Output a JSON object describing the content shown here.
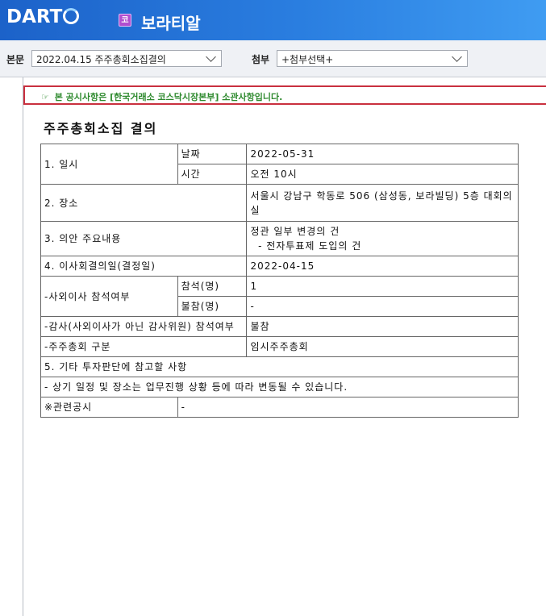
{
  "header": {
    "logo_text": "DART",
    "corp_badge": "코",
    "corp_name": "보라티알"
  },
  "toolbar": {
    "main_label": "본문",
    "main_select_value": "2022.04.15  주주총회소집결의",
    "attach_label": "첨부",
    "attach_select_value": "+첨부선택+"
  },
  "notice": {
    "icon": "☞",
    "text": "본 공시사항은 [한국거래소 코스닥시장본부] 소관사항입니다."
  },
  "document": {
    "title": "주주총회소집 결의",
    "rows": {
      "date_label": "1. 일시",
      "date_sub": "날짜",
      "date_value": "2022-05-31",
      "time_sub": "시간",
      "time_value": "오전 10시",
      "place_label": "2. 장소",
      "place_value": "서울시 강남구 학동로 506 (삼성동, 보라빌딩) 5층 대회의실",
      "agenda_label": "3. 의안 주요내용",
      "agenda_line1": "정관 일부 변경의 건",
      "agenda_line2": "  - 전자투표제 도입의 건",
      "board_label": "4. 이사회결의일(결정일)",
      "board_value": "2022-04-15",
      "outside_label": "-사외이사 참석여부",
      "attend_sub": "참석(명)",
      "attend_value": "1",
      "absent_sub": "불참(명)",
      "absent_value": "-",
      "auditor_label": "-감사(사외이사가 아닌 감사위원) 참석여부",
      "auditor_value": "불참",
      "meeting_type_label": "-주주총회 구분",
      "meeting_type_value": "임시주주총회",
      "other_label": "5. 기타 투자판단에 참고할 사항",
      "other_text": "- 상기 일정 및 장소는 업무진행 상황 등에 따라 변동될 수 있습니다.",
      "related_label": "※관련공시",
      "related_value": "-"
    }
  }
}
